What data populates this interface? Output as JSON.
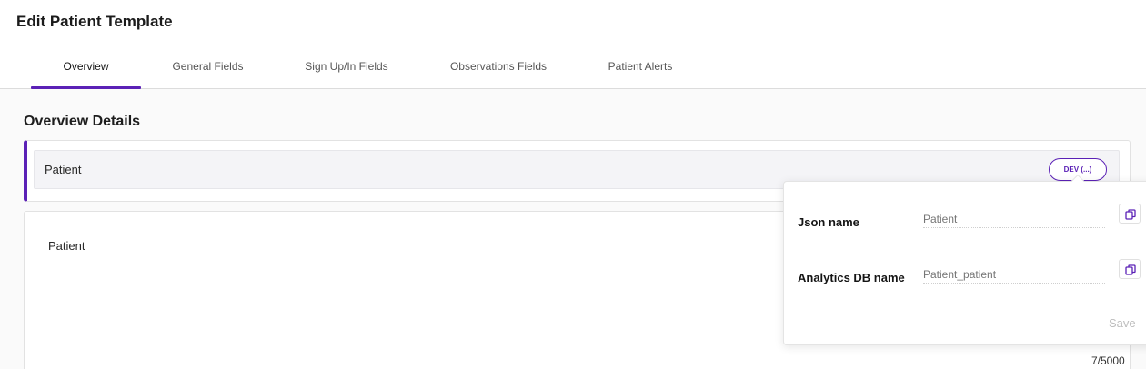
{
  "header": {
    "title": "Edit Patient Template"
  },
  "tabs": [
    {
      "label": "Overview",
      "active": true
    },
    {
      "label": "General Fields",
      "active": false
    },
    {
      "label": "Sign Up/In Fields",
      "active": false
    },
    {
      "label": "Observations Fields",
      "active": false
    },
    {
      "label": "Patient Alerts",
      "active": false
    }
  ],
  "overview": {
    "section_title": "Overview Details",
    "name_bar_label": "Patient",
    "env_badge": "DEV (...)",
    "description_value": "Patient",
    "char_count": "7/5000"
  },
  "popover": {
    "json_name_label": "Json name",
    "json_name_value": "Patient",
    "analytics_db_label": "Analytics DB name",
    "analytics_db_value": "Patient_patient",
    "save_label": "Save",
    "copy_icon": "copy-icon"
  },
  "colors": {
    "accent": "#5b21b6",
    "muted": "#bdbdbd"
  }
}
